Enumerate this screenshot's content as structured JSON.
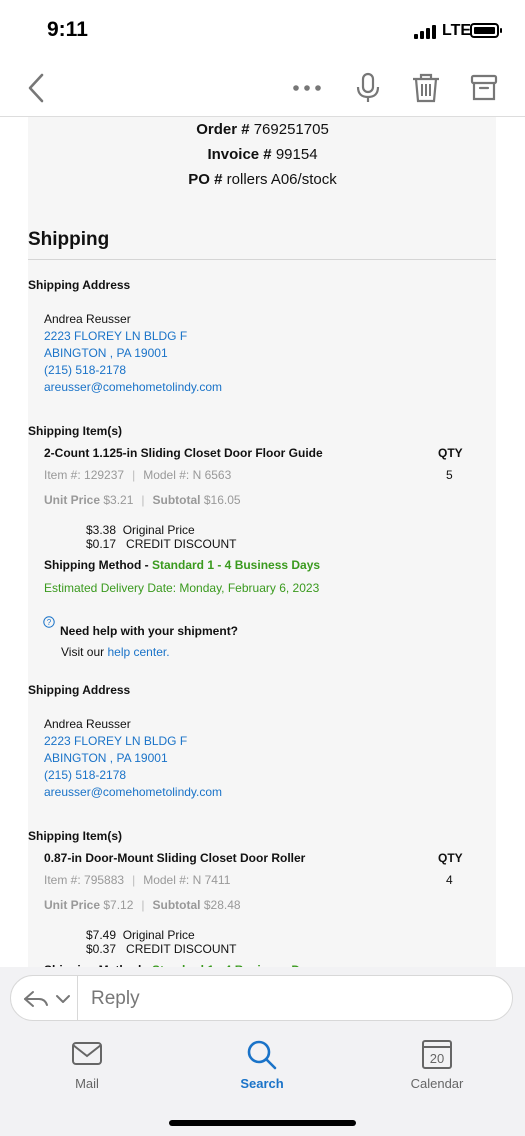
{
  "status_bar": {
    "time": "9:11",
    "network": "LTE"
  },
  "toolbar": {
    "icons": [
      "back-icon",
      "more-icon",
      "microphone-icon",
      "trash-icon",
      "archive-icon"
    ]
  },
  "header": {
    "order_label": "Order #",
    "order_value": "769251705",
    "invoice_label": "Invoice #",
    "invoice_value": "99154",
    "po_label": "PO #",
    "po_value": "rollers A06/stock"
  },
  "shipping": {
    "title": "Shipping",
    "address_label": "Shipping Address",
    "items_label": "Shipping Item(s)",
    "qty_label": "QTY",
    "item_label": "Item #:",
    "model_label": "Model #:",
    "unit_price_label": "Unit Price",
    "subtotal_label": "Subtotal",
    "original_price_label": "Original Price",
    "credit_discount_label": "CREDIT DISCOUNT",
    "method_label": "Shipping Method -",
    "method_value": "Standard 1 - 4 Business Days",
    "estimated_delivery": "Estimated Delivery Date: Monday, February 6, 2023",
    "help_title": "Need help with your shipment?",
    "help_prefix": "Visit our",
    "help_link": "help center.",
    "address": {
      "name": "Andrea Reusser",
      "street": "2223 FLOREY LN BLDG F",
      "city": "ABINGTON , PA 19001",
      "phone": "(215) 518-2178",
      "email": "areusser@comehometolindy.com"
    },
    "shipments": [
      {
        "item_name": "2-Count 1.125-in Sliding Closet Door Floor Guide",
        "item_number": "129237",
        "model_number": "N 6563",
        "qty": "5",
        "unit_price": "$3.21",
        "subtotal": "$16.05",
        "original_price": "$3.38",
        "credit_discount": "$0.17"
      },
      {
        "item_name": "0.87-in Door-Mount Sliding Closet Door Roller",
        "item_number": "795883",
        "model_number": "N 7411",
        "qty": "4",
        "unit_price": "$7.12",
        "subtotal": "$28.48",
        "original_price": "$7.49",
        "credit_discount": "$0.37"
      }
    ]
  },
  "reply": {
    "placeholder": "Reply"
  },
  "tabs": [
    {
      "label": "Mail",
      "icon": "mail-icon"
    },
    {
      "label": "Search",
      "icon": "search-icon"
    },
    {
      "label": "Calendar",
      "icon": "calendar-icon",
      "day": "20"
    }
  ],
  "colors": {
    "accent": "#1a73c8",
    "green": "#3a9a1e",
    "tab_inactive": "#666666"
  }
}
